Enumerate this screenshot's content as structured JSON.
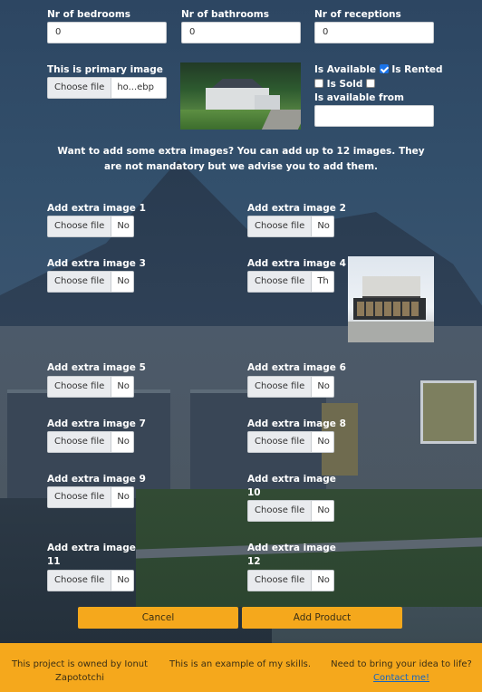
{
  "top_fields": [
    {
      "label": "Nr of bedrooms",
      "value": "0"
    },
    {
      "label": "Nr of bathrooms",
      "value": "0"
    },
    {
      "label": "Nr of receptions",
      "value": "0"
    }
  ],
  "primary_image": {
    "label": "This is primary image",
    "button": "Choose file",
    "file_name": "ho...ebp"
  },
  "status": {
    "is_available_label": "Is Available",
    "is_available_checked": true,
    "is_rented_label": "Is Rented",
    "is_rented_checked": false,
    "is_sold_label": "Is Sold",
    "is_sold_checked": false,
    "available_from_label": "Is available from",
    "available_from_value": ""
  },
  "note": "Want to add some extra images? You can add up to 12 images. They are not mandatory but we advise you to add them.",
  "extra_images": [
    {
      "label": "Add extra image 1",
      "button": "Choose file",
      "file_name": "No"
    },
    {
      "label": "Add extra image 2",
      "button": "Choose file",
      "file_name": "No"
    },
    {
      "label": "Add extra image 3",
      "button": "Choose file",
      "file_name": "No"
    },
    {
      "label": "Add extra image 4",
      "button": "Choose file",
      "file_name": "Th"
    },
    {
      "label": "Add extra image 5",
      "button": "Choose file",
      "file_name": "No"
    },
    {
      "label": "Add extra image 6",
      "button": "Choose file",
      "file_name": "No"
    },
    {
      "label": "Add extra image 7",
      "button": "Choose file",
      "file_name": "No"
    },
    {
      "label": "Add extra image 8",
      "button": "Choose file",
      "file_name": "No"
    },
    {
      "label": "Add extra image 9",
      "button": "Choose file",
      "file_name": "No"
    },
    {
      "label": "Add extra image 10",
      "button": "Choose file",
      "file_name": "No"
    },
    {
      "label": "Add extra image 11",
      "button": "Choose file",
      "file_name": "No"
    },
    {
      "label": "Add extra image 12",
      "button": "Choose file",
      "file_name": "No"
    }
  ],
  "actions": {
    "cancel": "Cancel",
    "add_product": "Add Product"
  },
  "footer": {
    "owner": "This project is owned by Ionut Zapototchi",
    "example": "This is an example of my skills.",
    "cta": "Need to bring your idea to life?",
    "contact": "Contact me!"
  },
  "colors": {
    "accent": "#f5a81c",
    "link": "#1565c0",
    "checkbox": "#1a73e8"
  }
}
